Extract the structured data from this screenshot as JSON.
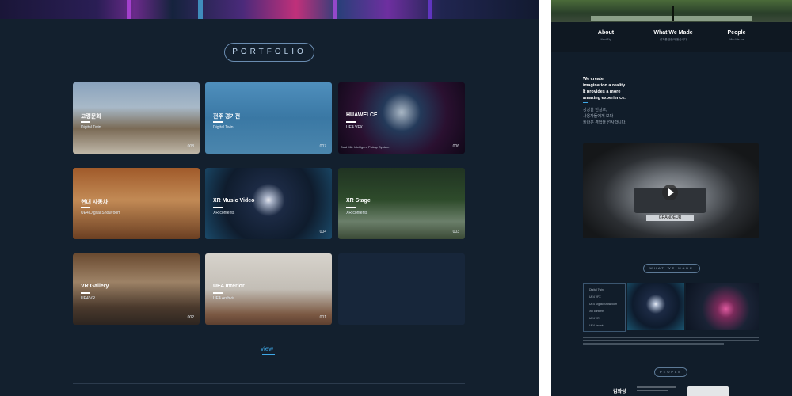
{
  "left": {
    "section_title": "PORTFOLIO",
    "view_link": "view",
    "cards": [
      {
        "title": "고령문화",
        "subtitle": "Digital Twin",
        "number": "008",
        "caption": ""
      },
      {
        "title": "전주 경기전",
        "subtitle": "Digital Twin",
        "number": "007",
        "caption": ""
      },
      {
        "title": "HUAWEI CF",
        "subtitle": "UE4 VFX",
        "number": "006",
        "caption": "Dual Mic Intelligent Pickup System"
      },
      {
        "title": "현대 자동차",
        "subtitle": "UE4 Digital Showroom",
        "number": "",
        "caption": ""
      },
      {
        "title": "XR Music Video",
        "subtitle": "XR contents",
        "number": "004",
        "caption": ""
      },
      {
        "title": "XR Stage",
        "subtitle": "XR contents",
        "number": "003",
        "caption": ""
      },
      {
        "title": "VR Gallery",
        "subtitle": "UE4 VR",
        "number": "002",
        "caption": ""
      },
      {
        "title": "UE4 Interior",
        "subtitle": "UE4 Archviz",
        "number": "001",
        "caption": ""
      }
    ]
  },
  "right": {
    "nav": [
      {
        "label": "About",
        "sub": "Next Fig"
      },
      {
        "label": "What We Made",
        "sub": "성과를 만들어 왔습니다"
      },
      {
        "label": "People",
        "sub": "Who We Are"
      }
    ],
    "tagline_en": [
      "We create",
      "imagination a reality.",
      "It provides a more",
      "amazing experience."
    ],
    "tagline_kr": [
      "상상을 현실로,",
      "사용자들에게 보다",
      "놀라운 경험을 선사합니다."
    ],
    "car_badge": "GRANDEUR",
    "what_we_made_label": "WHAT WE MADE",
    "menu": [
      "Digital Twin",
      "UE4 VFX",
      "UE4 Digital Showroom",
      "XR contents",
      "UE4 VR",
      "UE4 Archviz"
    ],
    "people_label": "PEOPLE",
    "person_name": "김화성"
  }
}
